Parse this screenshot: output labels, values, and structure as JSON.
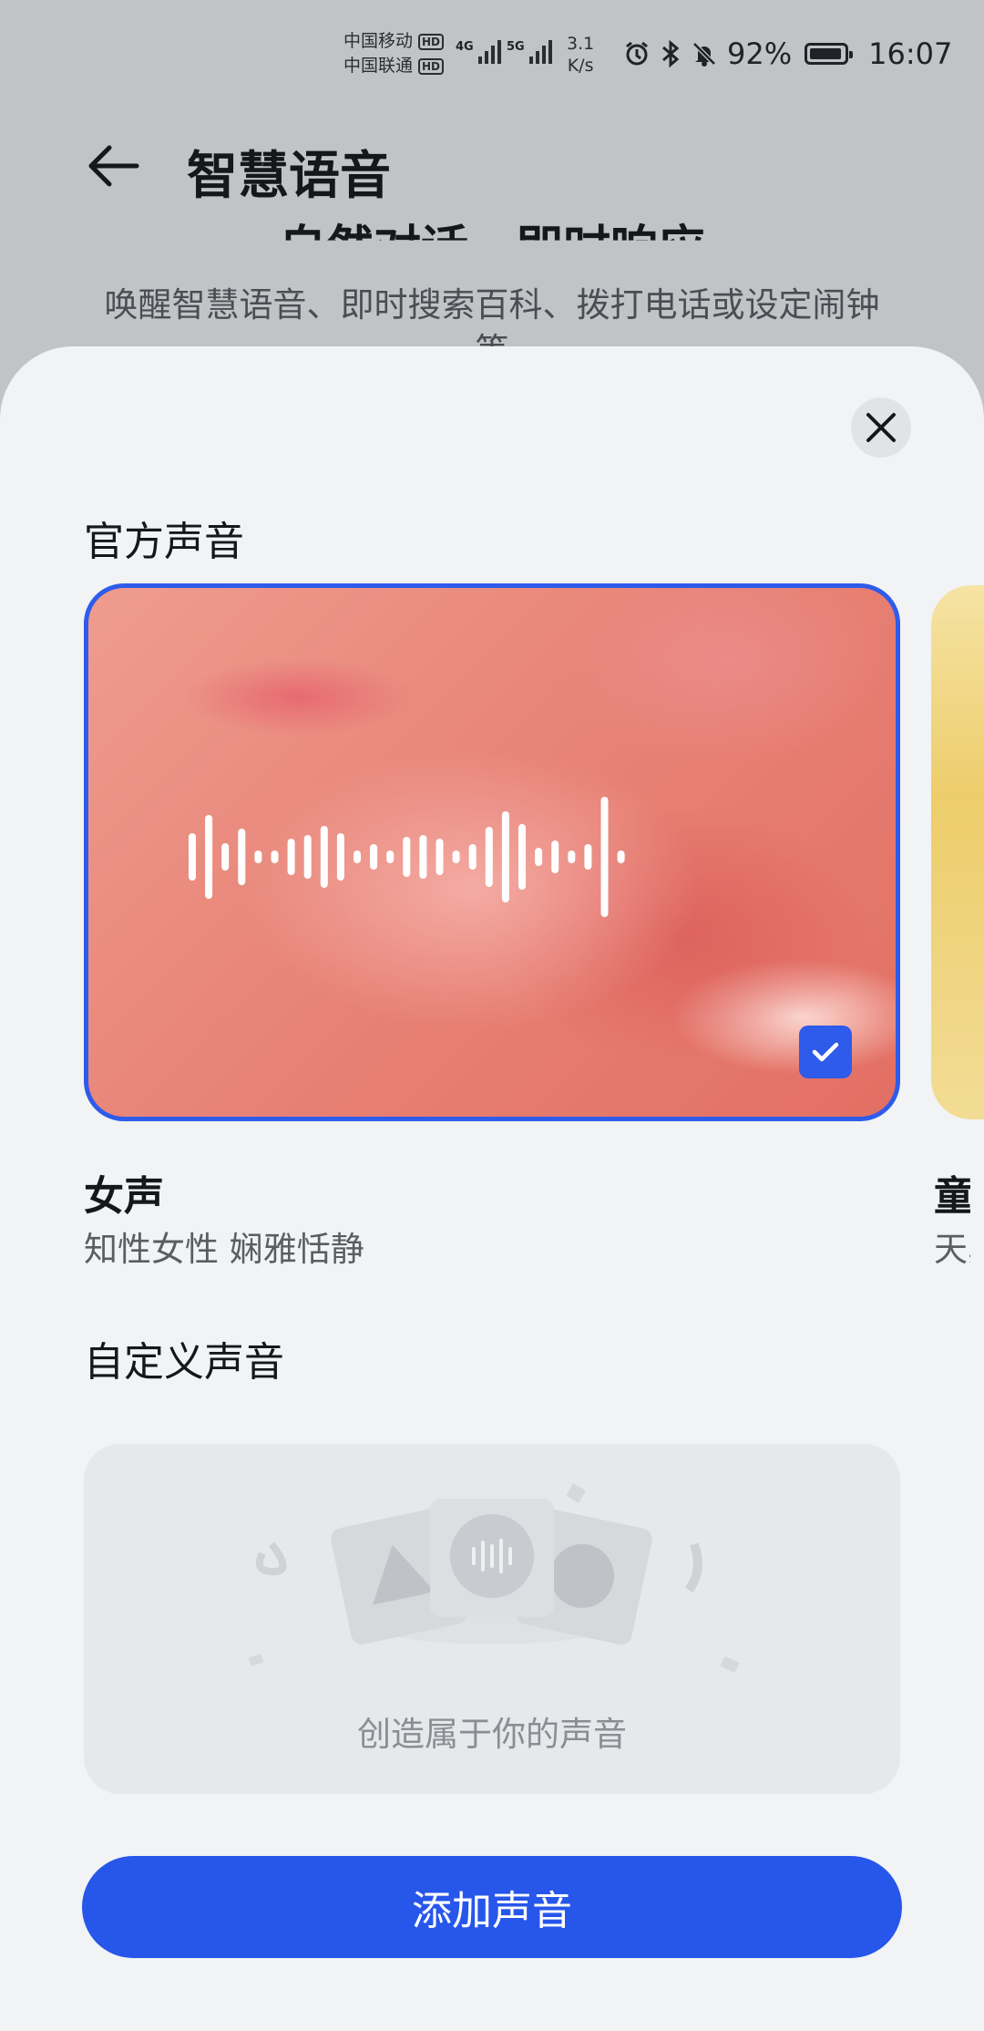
{
  "status_bar": {
    "carrier_1": "中国移动",
    "carrier_2": "中国联通",
    "hd_badge": "HD",
    "net_1": "4G",
    "net_2": "5G",
    "speed_value": "3.1",
    "speed_unit": "K/s",
    "battery": "92%",
    "time": "16:07"
  },
  "header": {
    "title": "智慧语音"
  },
  "background": {
    "heading": "自然对话，即时响应",
    "description": "唤醒智慧语音、即时搜索百科、拨打电话或设定闹钟等"
  },
  "sheet": {
    "official_section_title": "官方声音",
    "voices": [
      {
        "name": "女声",
        "description": "知性女性 娴雅恬静",
        "selected": true
      },
      {
        "name": "童声",
        "description": "天真可爱"
      }
    ],
    "custom_section_title": "自定义声音",
    "custom_empty_text": "创造属于你的声音",
    "add_button_label": "添加声音"
  },
  "colors": {
    "accent": "#2756ea",
    "selected_border": "#2f5bea",
    "sheet_bg": "#f1f3f5"
  }
}
